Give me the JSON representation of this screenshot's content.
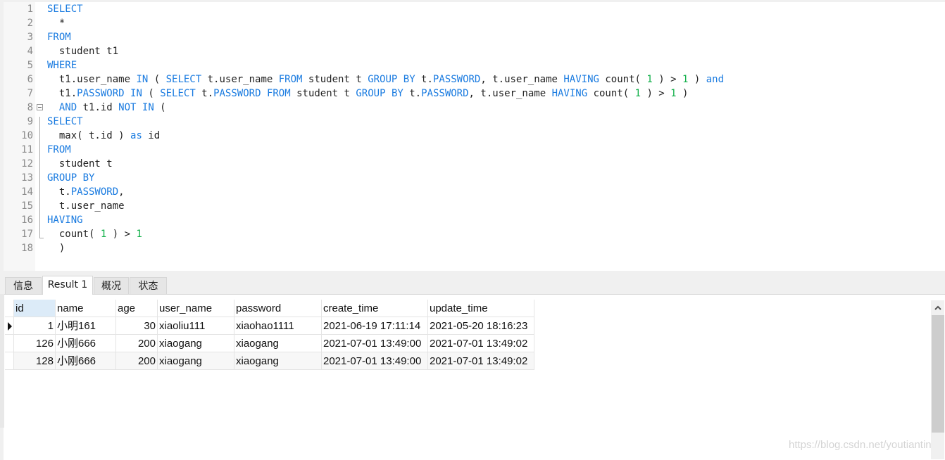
{
  "editor": {
    "lines": [
      {
        "n": "1",
        "tokens": [
          {
            "t": "SELECT",
            "c": "kw"
          }
        ]
      },
      {
        "n": "2",
        "tokens": [
          {
            "t": "  *",
            "c": ""
          }
        ]
      },
      {
        "n": "3",
        "tokens": [
          {
            "t": "FROM",
            "c": "kw"
          }
        ]
      },
      {
        "n": "4",
        "tokens": [
          {
            "t": "  student t1",
            "c": ""
          }
        ]
      },
      {
        "n": "5",
        "tokens": [
          {
            "t": "WHERE",
            "c": "kw"
          }
        ]
      },
      {
        "n": "6",
        "tokens": [
          {
            "t": "  t1.user_name ",
            "c": ""
          },
          {
            "t": "IN",
            "c": "kw"
          },
          {
            "t": " ( ",
            "c": ""
          },
          {
            "t": "SELECT",
            "c": "kw"
          },
          {
            "t": " t.user_name ",
            "c": ""
          },
          {
            "t": "FROM",
            "c": "kw"
          },
          {
            "t": " student t ",
            "c": ""
          },
          {
            "t": "GROUP BY",
            "c": "kw"
          },
          {
            "t": " t.",
            "c": ""
          },
          {
            "t": "PASSWORD",
            "c": "kw"
          },
          {
            "t": ", t.user_name ",
            "c": ""
          },
          {
            "t": "HAVING",
            "c": "kw"
          },
          {
            "t": " count( ",
            "c": ""
          },
          {
            "t": "1",
            "c": "num"
          },
          {
            "t": " ) > ",
            "c": ""
          },
          {
            "t": "1",
            "c": "num"
          },
          {
            "t": " ) ",
            "c": ""
          },
          {
            "t": "and",
            "c": "kw"
          }
        ]
      },
      {
        "n": "7",
        "tokens": [
          {
            "t": "  t1.",
            "c": ""
          },
          {
            "t": "PASSWORD",
            "c": "kw"
          },
          {
            "t": " ",
            "c": ""
          },
          {
            "t": "IN",
            "c": "kw"
          },
          {
            "t": " ( ",
            "c": ""
          },
          {
            "t": "SELECT",
            "c": "kw"
          },
          {
            "t": " t.",
            "c": ""
          },
          {
            "t": "PASSWORD",
            "c": "kw"
          },
          {
            "t": " ",
            "c": ""
          },
          {
            "t": "FROM",
            "c": "kw"
          },
          {
            "t": " student t ",
            "c": ""
          },
          {
            "t": "GROUP BY",
            "c": "kw"
          },
          {
            "t": " t.",
            "c": ""
          },
          {
            "t": "PASSWORD",
            "c": "kw"
          },
          {
            "t": ", t.user_name ",
            "c": ""
          },
          {
            "t": "HAVING",
            "c": "kw"
          },
          {
            "t": " count( ",
            "c": ""
          },
          {
            "t": "1",
            "c": "num"
          },
          {
            "t": " ) > ",
            "c": ""
          },
          {
            "t": "1",
            "c": "num"
          },
          {
            "t": " )",
            "c": ""
          }
        ]
      },
      {
        "n": "8",
        "fold": true,
        "tokens": [
          {
            "t": "  ",
            "c": ""
          },
          {
            "t": "AND",
            "c": "kw"
          },
          {
            "t": " t1.id ",
            "c": ""
          },
          {
            "t": "NOT IN",
            "c": "kw"
          },
          {
            "t": " (",
            "c": ""
          }
        ]
      },
      {
        "n": "9",
        "tokens": [
          {
            "t": "SELECT",
            "c": "kw"
          }
        ]
      },
      {
        "n": "10",
        "tokens": [
          {
            "t": "  max( t.id ) ",
            "c": ""
          },
          {
            "t": "as",
            "c": "kw"
          },
          {
            "t": " id",
            "c": ""
          }
        ]
      },
      {
        "n": "11",
        "tokens": [
          {
            "t": "FROM",
            "c": "kw"
          }
        ]
      },
      {
        "n": "12",
        "tokens": [
          {
            "t": "  student t",
            "c": ""
          }
        ]
      },
      {
        "n": "13",
        "tokens": [
          {
            "t": "GROUP BY",
            "c": "kw"
          }
        ]
      },
      {
        "n": "14",
        "tokens": [
          {
            "t": "  t.",
            "c": ""
          },
          {
            "t": "PASSWORD",
            "c": "kw"
          },
          {
            "t": ",",
            "c": ""
          }
        ]
      },
      {
        "n": "15",
        "tokens": [
          {
            "t": "  t.user_name",
            "c": ""
          }
        ]
      },
      {
        "n": "16",
        "tokens": [
          {
            "t": "HAVING",
            "c": "kw"
          }
        ]
      },
      {
        "n": "17",
        "tokens": [
          {
            "t": "  count( ",
            "c": ""
          },
          {
            "t": "1",
            "c": "num"
          },
          {
            "t": " ) > ",
            "c": ""
          },
          {
            "t": "1",
            "c": "num"
          }
        ]
      },
      {
        "n": "18",
        "tokens": [
          {
            "t": "  )",
            "c": ""
          }
        ]
      }
    ],
    "colors": {
      "keyword": "#1a7be0",
      "number": "#12b04a",
      "text": "#222222"
    }
  },
  "tabs": [
    {
      "label": "信息",
      "active": false
    },
    {
      "label": "Result 1",
      "active": true
    },
    {
      "label": "概况",
      "active": false
    },
    {
      "label": "状态",
      "active": false
    }
  ],
  "result": {
    "columns": [
      "id",
      "name",
      "age",
      "user_name",
      "password",
      "create_time",
      "update_time"
    ],
    "rows": [
      [
        "1",
        "小明161",
        "30",
        "xiaoliu111",
        "xiaohao1111",
        "2021-06-19 17:11:14",
        "2021-05-20 18:16:23"
      ],
      [
        "126",
        "小刚666",
        "200",
        "xiaogang",
        "xiaogang",
        "2021-07-01 13:49:00",
        "2021-07-01 13:49:02"
      ],
      [
        "128",
        "小刚666",
        "200",
        "xiaogang",
        "xiaogang",
        "2021-07-01 13:49:00",
        "2021-07-01 13:49:02"
      ]
    ],
    "selected_row": 0,
    "selected_column": "id"
  },
  "scrollbar": {
    "up_arrow": "▲"
  },
  "watermark": "https://blog.csdn.net/youtiantin"
}
